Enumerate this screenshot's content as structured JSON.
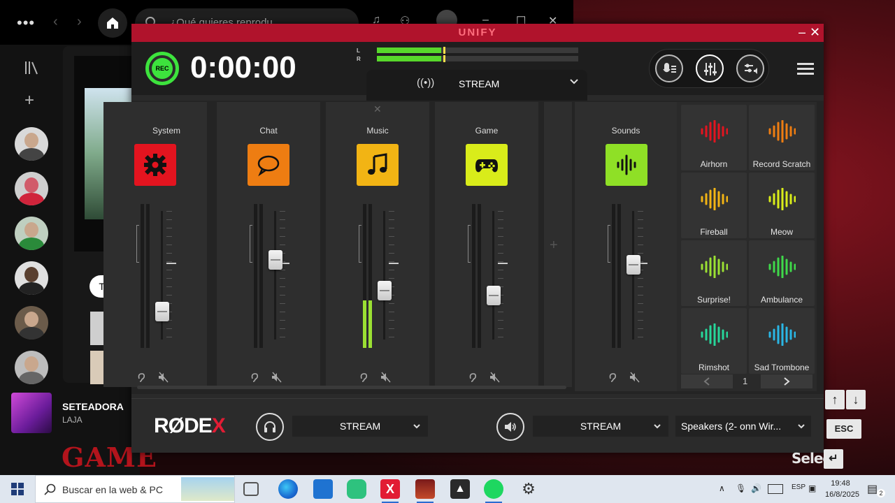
{
  "spotify": {
    "search_placeholder": "¿Qué quieres reprodu",
    "filter_chip": "Todo",
    "now_playing": {
      "title": "SETEADORA",
      "artist": "LAJA"
    }
  },
  "game": {
    "logo_text": "GAME",
    "select_label": "Select",
    "esc_label": "ESC"
  },
  "unify": {
    "title": "UNIFY",
    "timer": "0:00:00",
    "meter": {
      "left_label": "L",
      "right_label": "R",
      "left_level_pct": 32,
      "right_level_pct": 32,
      "peak_pct": 33
    },
    "mix_selector": "STREAM",
    "channels": [
      {
        "name": "System",
        "color": "#e3141f",
        "icon": "gear-icon",
        "fader_pct": 22,
        "level_pct": 0
      },
      {
        "name": "Chat",
        "color": "#ee7d12",
        "icon": "chat-bubble-icon",
        "fader_pct": 62,
        "level_pct": 0
      },
      {
        "name": "Music",
        "color": "#f2b414",
        "icon": "music-note-icon",
        "fader_pct": 38,
        "level_pct": 33
      },
      {
        "name": "Game",
        "color": "#d9ec1a",
        "icon": "gamepad-icon",
        "fader_pct": 34,
        "level_pct": 0
      },
      {
        "name": "Sounds",
        "color": "#8fe026",
        "icon": "waveform-icon",
        "fader_pct": 58,
        "level_pct": 0
      }
    ],
    "sound_pads": [
      {
        "label": "Airhorn",
        "color": "#e3141f"
      },
      {
        "label": "Record Scratch",
        "color": "#ee7d12"
      },
      {
        "label": "Fireball",
        "color": "#f2b414"
      },
      {
        "label": "Meow",
        "color": "#d9ec1a"
      },
      {
        "label": "Surprise!",
        "color": "#9be033"
      },
      {
        "label": "Ambulance",
        "color": "#3fd84a"
      },
      {
        "label": "Rimshot",
        "color": "#27d69a"
      },
      {
        "label": "Sad Trombone",
        "color": "#2ab6e4"
      }
    ],
    "page": "1",
    "footer": {
      "brand_main": "RØDE",
      "brand_accent": "X",
      "headphone_mix": "STREAM",
      "speaker_mix": "STREAM",
      "output_device": "Speakers (2- onn Wir..."
    }
  },
  "taskbar": {
    "search_placeholder": "Buscar en la web & PC",
    "language": "ESP",
    "time": "19:48",
    "date": "16/8/2025",
    "notification_count": "2"
  }
}
